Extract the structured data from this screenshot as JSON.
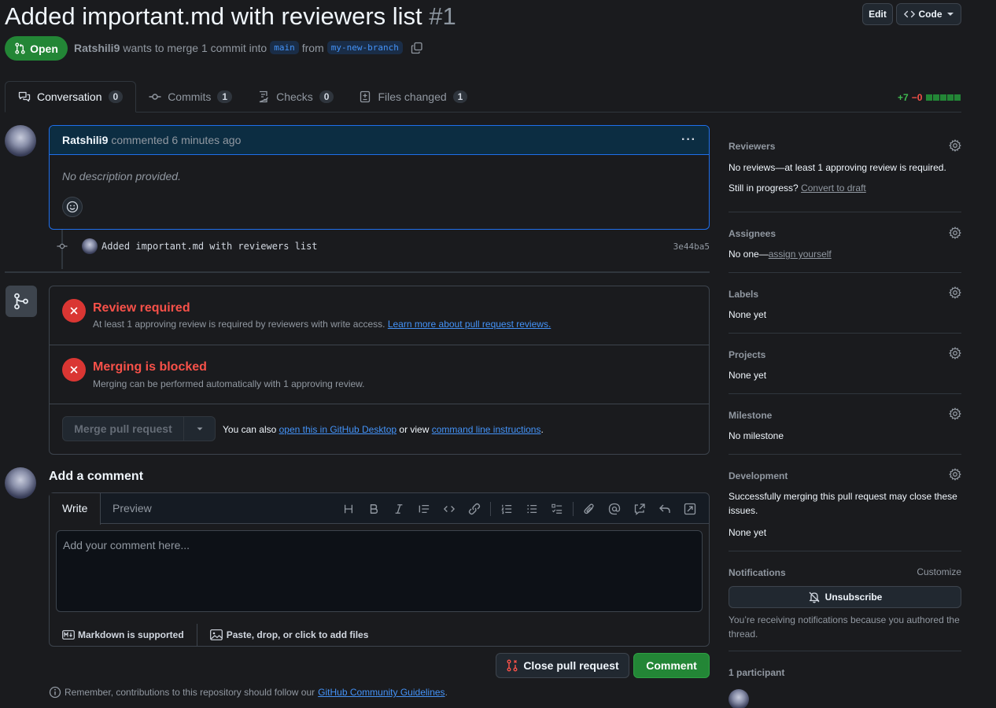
{
  "header": {
    "title": "Added important.md with reviewers list",
    "number": "#1",
    "edit_label": "Edit",
    "code_label": "Code",
    "state": "Open",
    "author": "Ratshili9",
    "merge_text": "wants to merge 1 commit into",
    "base_branch": "main",
    "from_text": "from",
    "head_branch": "my-new-branch"
  },
  "tabs": [
    {
      "label": "Conversation",
      "count": "0"
    },
    {
      "label": "Commits",
      "count": "1"
    },
    {
      "label": "Checks",
      "count": "0"
    },
    {
      "label": "Files changed",
      "count": "1"
    }
  ],
  "diffstat": {
    "additions": "+7",
    "deletions": "−0"
  },
  "comment": {
    "author": "Ratshili9",
    "action": "commented",
    "time": "6 minutes ago",
    "body": "No description provided."
  },
  "commit": {
    "message": "Added important.md with reviewers list",
    "sha": "3e44ba5"
  },
  "merge": {
    "review_title": "Review required",
    "review_desc": "At least 1 approving review is required by reviewers with write access.",
    "review_link": "Learn more about pull request reviews.",
    "blocked_title": "Merging is blocked",
    "blocked_desc": "Merging can be performed automatically with 1 approving review.",
    "merge_button": "Merge pull request",
    "also_text": "You can also",
    "desktop_link": "open this in GitHub Desktop",
    "or_view": "or view",
    "cli_link": "command line instructions",
    "period": "."
  },
  "add_comment": {
    "title": "Add a comment",
    "write_tab": "Write",
    "preview_tab": "Preview",
    "placeholder": "Add your comment here...",
    "markdown_note": "Markdown is supported",
    "attach_note": "Paste, drop, or click to add files",
    "close_button": "Close pull request",
    "comment_button": "Comment",
    "footnote_pre": "Remember, contributions to this repository should follow our",
    "footnote_link": "GitHub Community Guidelines",
    "footnote_post": "."
  },
  "sidebar": {
    "reviewers": {
      "title": "Reviewers",
      "text": "No reviews—at least 1 approving review is required.",
      "progress_text": "Still in progress?",
      "progress_link": "Convert to draft"
    },
    "assignees": {
      "title": "Assignees",
      "text": "No one—",
      "link": "assign yourself"
    },
    "labels": {
      "title": "Labels",
      "text": "None yet"
    },
    "projects": {
      "title": "Projects",
      "text": "None yet"
    },
    "milestone": {
      "title": "Milestone",
      "text": "No milestone"
    },
    "development": {
      "title": "Development",
      "text": "Successfully merging this pull request may close these issues.",
      "text2": "None yet"
    },
    "notifications": {
      "title": "Notifications",
      "customize": "Customize",
      "unsubscribe": "Unsubscribe",
      "note": "You’re receiving notifications because you authored the thread."
    },
    "participants": {
      "title": "1 participant"
    }
  },
  "colors": {
    "accent": "#1f6feb",
    "open_green": "#238636",
    "danger": "#da3633",
    "link": "#4493f8"
  }
}
